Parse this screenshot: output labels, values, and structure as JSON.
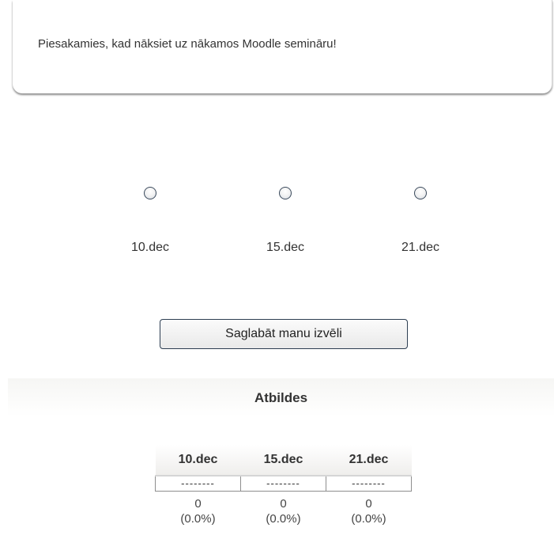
{
  "intro": {
    "text": "Piesakamies, kad nāksiet uz nākamos Moodle semināru!"
  },
  "options": [
    {
      "label": "10.dec",
      "selected": false
    },
    {
      "label": "15.dec",
      "selected": false
    },
    {
      "label": "21.dec",
      "selected": false
    }
  ],
  "submit": {
    "label": "Saglabāt manu izvēli"
  },
  "results": {
    "heading": "Atbildes",
    "columns": [
      {
        "header": "10.dec",
        "bar": "--------",
        "count": "0",
        "percent": "(0.0%)"
      },
      {
        "header": "15.dec",
        "bar": "--------",
        "count": "0",
        "percent": "(0.0%)"
      },
      {
        "header": "21.dec",
        "bar": "--------",
        "count": "0",
        "percent": "(0.0%)"
      }
    ]
  },
  "colors": {
    "text": "#333333",
    "radio_border": "#3b4a5c",
    "button_border": "#2d3e52",
    "table_border": "#8e8e8e"
  }
}
